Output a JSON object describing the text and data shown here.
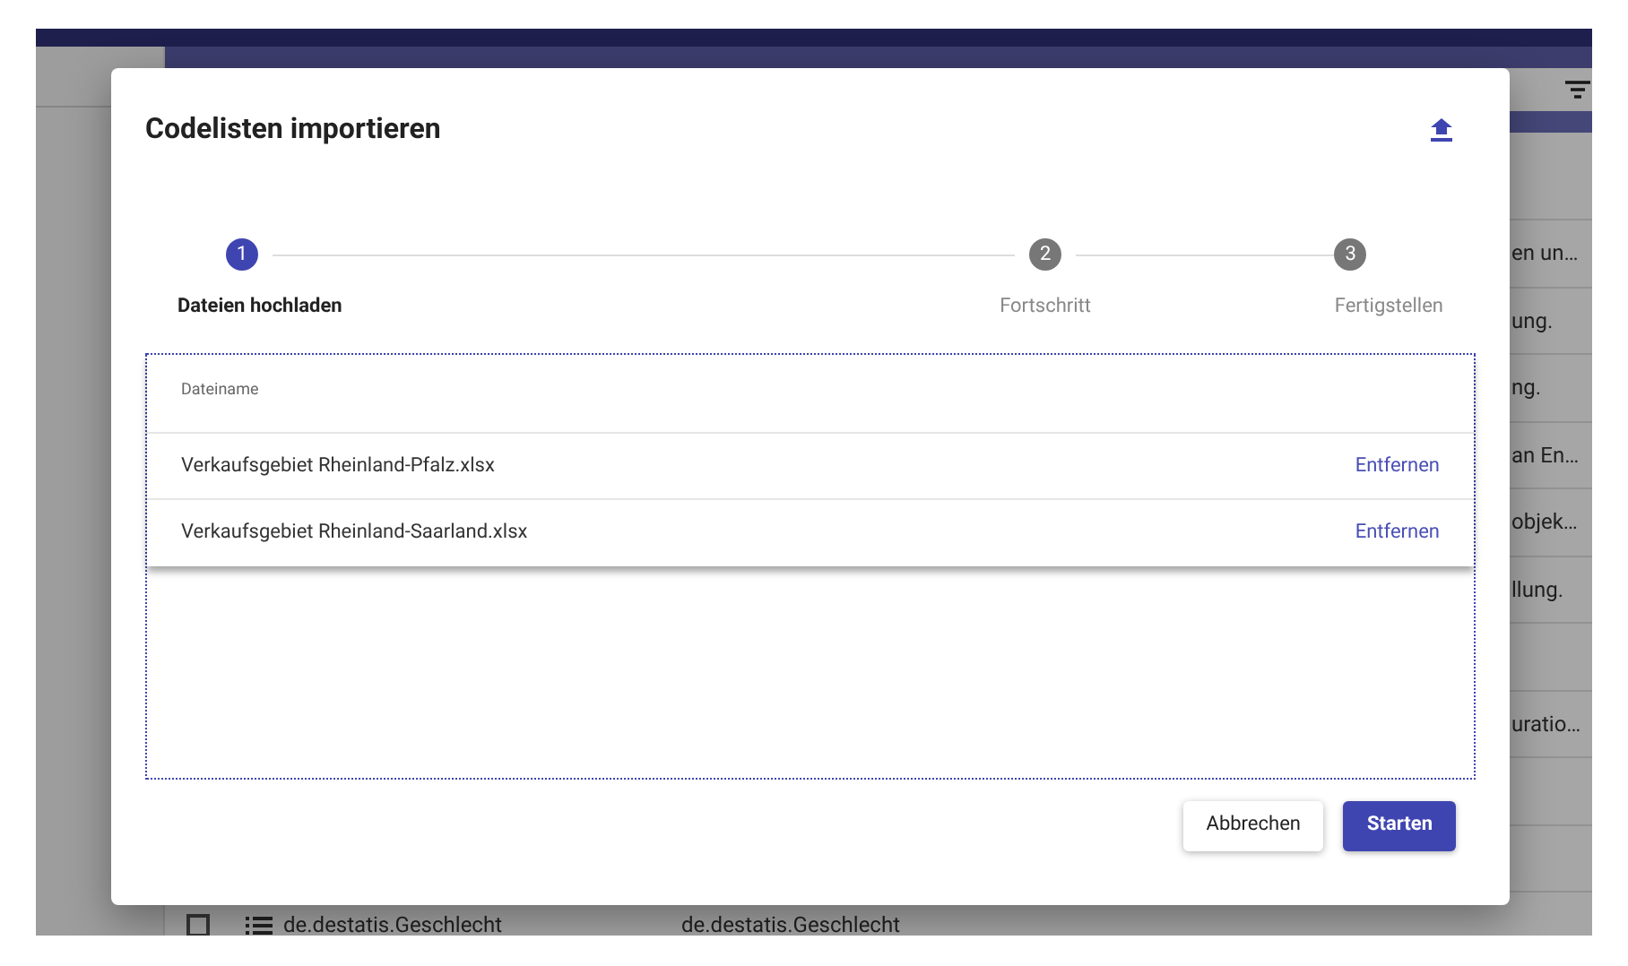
{
  "background": {
    "rows": [
      {
        "column_3": "en un…"
      },
      {
        "column_3": "ung."
      },
      {
        "column_3": "ng."
      },
      {
        "column_3": "an En…"
      },
      {
        "column_3": "objek…"
      },
      {
        "column_3": "llung."
      },
      {},
      {
        "column_3": "uratio…"
      },
      {},
      {},
      {
        "column_1": "de.destatis.Geschlecht",
        "column_2": "de.destatis.Geschlecht",
        "checked": false
      }
    ]
  },
  "dialog": {
    "title": "Codelisten importieren",
    "steps": [
      {
        "number": "1",
        "label": "Dateien hochladen",
        "active": true
      },
      {
        "number": "2",
        "label": "Fortschritt",
        "active": false
      },
      {
        "number": "3",
        "label": "Fertigstellen",
        "active": false
      }
    ],
    "files": {
      "column": "Dateiname",
      "rows": [
        {
          "name": "Verkaufsgebiet Rheinland-Pfalz.xlsx",
          "action": "Entfernen"
        },
        {
          "name": "Verkaufsgebiet Rheinland-Saarland.xlsx",
          "action": "Entfernen"
        }
      ]
    },
    "buttons": [
      {
        "label": "Abbrechen",
        "kind": "secondary"
      },
      {
        "label": "Starten",
        "kind": "primary"
      }
    ]
  }
}
